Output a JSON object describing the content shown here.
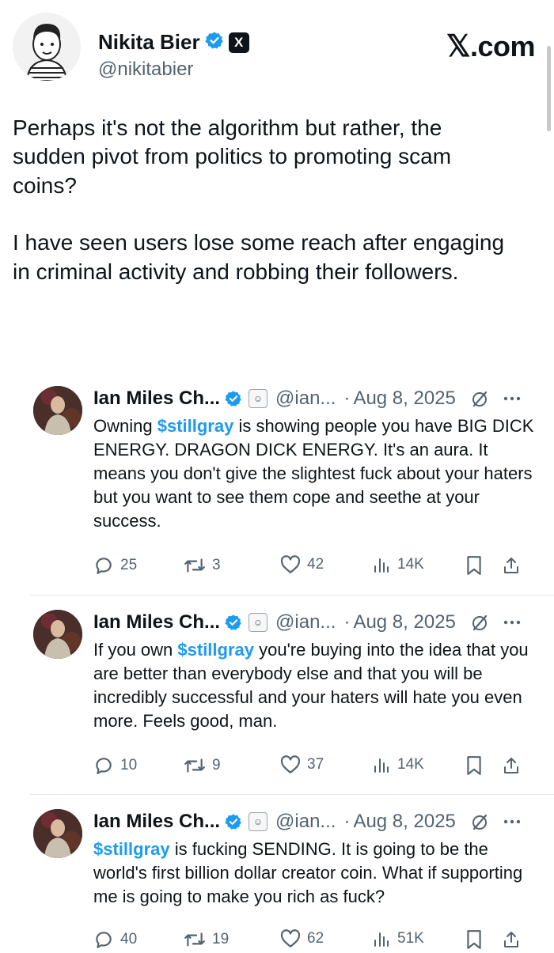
{
  "author": {
    "name": "Nikita Bier",
    "handle": "@nikitabier"
  },
  "site": {
    "label": ".com",
    "x_mark": "𝕏"
  },
  "tweet": {
    "paragraph_1": "Perhaps it's not the algorithm but rather, the sudden pivot from politics to promoting scam coins?",
    "paragraph_2": "I have seen users lose some reach after engaging in criminal activity and robbing their followers."
  },
  "quoted_posts": [
    {
      "name": "Ian Miles Ch...",
      "handle": "@ian...",
      "separator": "·",
      "date": "Aug 8, 2025",
      "text_before": "Owning ",
      "cashtag": "$stillgray",
      "text_after": " is showing people you have BIG DICK ENERGY. DRAGON DICK ENERGY. It's an aura. It means you don't give the slightest fuck about your haters but you want to see them cope and seethe at your success.",
      "replies": "25",
      "reposts": "3",
      "likes": "42",
      "views": "14K"
    },
    {
      "name": "Ian Miles Ch...",
      "handle": "@ian...",
      "separator": "·",
      "date": "Aug 8, 2025",
      "text_before": "If you own ",
      "cashtag": "$stillgray",
      "text_after": " you're buying into the idea that you are better than everybody else and that you will be incredibly successful and your haters will hate you even more. Feels good, man.",
      "replies": "10",
      "reposts": "9",
      "likes": "37",
      "views": "14K"
    },
    {
      "name": "Ian Miles Ch...",
      "handle": "@ian...",
      "separator": "·",
      "date": "Aug 8, 2025",
      "text_before": "",
      "cashtag": "$stillgray",
      "text_after": " is fucking SENDING. It is going to be the world's first billion dollar creator coin. What if supporting me is going to make you rich as fuck?",
      "replies": "40",
      "reposts": "19",
      "likes": "62",
      "views": "51K"
    }
  ],
  "colors": {
    "accent": "#1d9bf0",
    "text": "#0f1419",
    "secondary": "#536471"
  }
}
